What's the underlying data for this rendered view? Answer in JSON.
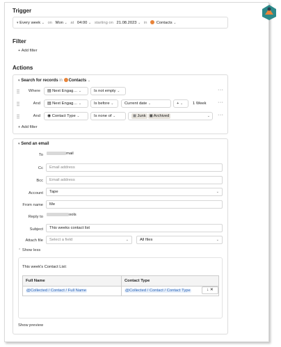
{
  "colors": {
    "accent": "#e8843a",
    "logo_teal": "#2c8a8a",
    "token_blue": "#2a64b8"
  },
  "trigger": {
    "heading": "Trigger",
    "frequency": "Every week",
    "on_label": "on",
    "day": "Mon",
    "at_label": "at",
    "time": "04:00",
    "starting_label": "starting on",
    "date": "21.08.2023",
    "in_label": "in",
    "table": "Contacts"
  },
  "filter": {
    "heading": "Filter",
    "add_label": "Add filter"
  },
  "actions": {
    "heading": "Actions",
    "search": {
      "title": "Search for records",
      "in_label": "in",
      "table": "Contacts",
      "rows": [
        {
          "conj": "Where",
          "field": "Next Engag…",
          "op": "Is not empty"
        },
        {
          "conj": "And",
          "field": "Next Engag…",
          "op": "Is before",
          "value": "Current date",
          "plus": "+",
          "amount": "1 Week"
        },
        {
          "conj": "And",
          "field": "Contact Type",
          "op": "Is none of",
          "tags": [
            "Junk",
            "Archived"
          ]
        }
      ],
      "add_filter": "Add filter"
    },
    "email": {
      "title": "Send an email",
      "to_label": "To",
      "to_value": "mail",
      "cc_label": "Cc",
      "cc_placeholder": "Email address",
      "bcc_label": "Bcc",
      "bcc_placeholder": "Email address",
      "account_label": "Account",
      "account_value": "Tape",
      "fromname_label": "From name",
      "fromname_value": "Me",
      "replyto_label": "Reply to",
      "replyto_value": "ools",
      "subject_label": "Subject",
      "subject_value": "This weeks contact list",
      "attach_label": "Attach file",
      "attach_placeholder": "Select a field",
      "attach_filter": "All files",
      "show_less": "Show less",
      "body_intro": "This week's Contact List:",
      "table_headers": [
        "Full Name",
        "Contact Type"
      ],
      "table_row": [
        "@Collected / Contact / Full Name",
        "@Collected / Contact / Contact Type"
      ],
      "show_preview": "Show preview"
    }
  }
}
